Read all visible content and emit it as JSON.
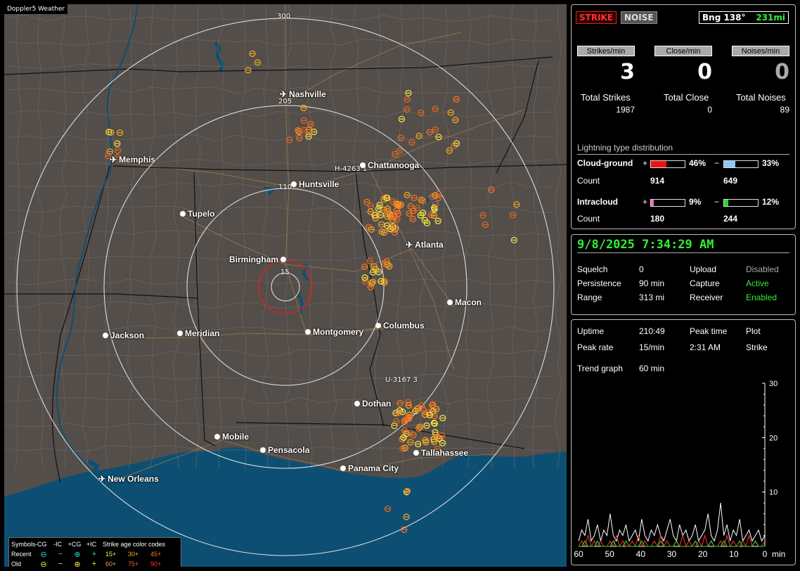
{
  "map": {
    "title": "Doppler5 Weather",
    "ring_labels": [
      "300",
      "205",
      "110",
      "15"
    ],
    "cities": [
      {
        "name": "Nashville",
        "kind": "airport"
      },
      {
        "name": "Memphis",
        "kind": "airport"
      },
      {
        "name": "Chattanooga",
        "kind": "dot"
      },
      {
        "name": "Huntsville",
        "kind": "dot"
      },
      {
        "name": "Tupelo",
        "kind": "dot"
      },
      {
        "name": "Atlanta",
        "kind": "airport"
      },
      {
        "name": "Birmingham",
        "kind": "dot"
      },
      {
        "name": "Macon",
        "kind": "dot"
      },
      {
        "name": "Jackson",
        "kind": "dot"
      },
      {
        "name": "Meridian",
        "kind": "dot"
      },
      {
        "name": "Montgomery",
        "kind": "dot"
      },
      {
        "name": "Columbus",
        "kind": "dot"
      },
      {
        "name": "Dothan",
        "kind": "dot"
      },
      {
        "name": "Mobile",
        "kind": "dot"
      },
      {
        "name": "Pensacola",
        "kind": "dot"
      },
      {
        "name": "Tallahassee",
        "kind": "dot"
      },
      {
        "name": "Panama City",
        "kind": "dot"
      },
      {
        "name": "New Orleans",
        "kind": "airport"
      }
    ],
    "highway_labels": [
      "H-4263 1",
      "U-3167 3"
    ],
    "colors": {
      "land": "#544e4a",
      "water": "#0d4f73",
      "ring": "#e8e8e8",
      "center_ring": "#e02020"
    }
  },
  "legend": {
    "header": [
      "Symbols",
      "-CG",
      "-IC",
      "+CG",
      "+IC",
      "Strike age color codes"
    ],
    "recent": {
      "label": "Recent",
      "ages": [
        "15+",
        "30+",
        "45+"
      ]
    },
    "old": {
      "label": "Old",
      "ages": [
        "60+",
        "75+",
        "90+"
      ]
    },
    "symbols": [
      "⊖",
      "−",
      "⊕",
      "+"
    ]
  },
  "status": {
    "strike_label": "STRIKE",
    "noise_label": "NOISE",
    "bearing_label": "Bng 138°",
    "distance_label": "231mi"
  },
  "rates": {
    "strikes_label": "Strikes/min",
    "strikes_value": "3",
    "close_label": "Close/min",
    "close_value": "0",
    "noises_label": "Noises/min",
    "noises_value": "0"
  },
  "totals": {
    "strikes_label": "Total Strikes",
    "strikes_value": "1987",
    "close_label": "Total Close",
    "close_value": "0",
    "noises_label": "Total Noises",
    "noises_value": "89"
  },
  "distribution": {
    "title": "Lightning type distribution",
    "cg_label": "Cloud-ground",
    "cg_plus_sign": "+",
    "cg_plus_pct": "46%",
    "cg_plus_fraction": 0.46,
    "cg_plus_color": "#ee1111",
    "cg_minus_sign": "−",
    "cg_minus_pct": "33%",
    "cg_minus_fraction": 0.33,
    "cg_minus_color": "#88c8ff",
    "cg_count_label": "Count",
    "cg_plus_count": "914",
    "cg_minus_count": "649",
    "ic_label": "Intracloud",
    "ic_plus_sign": "+",
    "ic_plus_pct": "9%",
    "ic_plus_fraction": 0.09,
    "ic_plus_color": "#ff66bb",
    "ic_minus_sign": "−",
    "ic_minus_pct": "12%",
    "ic_minus_fraction": 0.12,
    "ic_minus_color": "#22dd22",
    "ic_count_label": "Count",
    "ic_plus_count": "180",
    "ic_minus_count": "244"
  },
  "datetime": "9/8/2025 7:34:29 AM",
  "settings": {
    "squelch_label": "Squelch",
    "squelch_value": "0",
    "upload_label": "Upload",
    "upload_value": "Disabled",
    "persistence_label": "Persistence",
    "persistence_value": "90 min",
    "capture_label": "Capture",
    "capture_value": "Active",
    "range_label": "Range",
    "range_value": "313 mi",
    "receiver_label": "Receiver",
    "receiver_value": "Enabled"
  },
  "stats": {
    "uptime_label": "Uptime",
    "uptime_value": "210:49",
    "peak_time_label": "Peak time",
    "plot_label": "Plot",
    "peak_rate_label": "Peak rate",
    "peak_rate_value": "15/min",
    "peak_time_value": "2:31 AM",
    "plot_value": "Strike",
    "trend_label": "Trend graph",
    "trend_value": "60 min"
  },
  "chart_data": {
    "type": "line",
    "x_ticks": [
      "60",
      "50",
      "40",
      "30",
      "20",
      "10",
      "0"
    ],
    "x_unit": "min",
    "y_ticks": [
      "30",
      "20",
      "10"
    ],
    "ylim": [
      0,
      30
    ],
    "xlim": [
      60,
      0
    ],
    "series": [
      {
        "color": "#ffffff",
        "values": [
          1,
          3,
          2,
          5,
          1,
          2,
          4,
          1,
          3,
          2,
          6,
          2,
          1,
          3,
          2,
          4,
          1,
          2,
          3,
          1,
          5,
          2,
          1,
          3,
          2,
          4,
          2,
          1,
          3,
          5,
          2,
          1,
          4,
          2,
          3,
          1,
          2,
          4,
          1,
          2,
          3,
          6,
          2,
          1,
          3,
          8,
          2,
          4,
          1,
          3,
          2,
          5,
          1,
          2,
          3,
          1,
          2,
          3,
          1,
          2
        ]
      },
      {
        "color": "#ff3333",
        "values": [
          0,
          1,
          0,
          2,
          0,
          1,
          0,
          1,
          0,
          0,
          1,
          0,
          2,
          0,
          1,
          0,
          0,
          1,
          0,
          2,
          0,
          1,
          0,
          0,
          1,
          0,
          2,
          0,
          1,
          0,
          0,
          1,
          0,
          2,
          0,
          1,
          0,
          0,
          1,
          0,
          2,
          0,
          1,
          0,
          0,
          1,
          0,
          2,
          0,
          1,
          0,
          0,
          1,
          0,
          2,
          0,
          1,
          0,
          0,
          1
        ]
      },
      {
        "color": "#33dd33",
        "values": [
          0,
          0,
          1,
          0,
          0,
          0,
          1,
          0,
          0,
          0,
          0,
          1,
          0,
          0,
          0,
          1,
          0,
          0,
          0,
          0,
          1,
          0,
          0,
          0,
          0,
          0,
          1,
          0,
          0,
          0,
          0,
          1,
          0,
          0,
          0,
          0,
          0,
          1,
          0,
          0,
          0,
          0,
          1,
          0,
          0,
          0,
          1,
          0,
          0,
          0,
          0,
          1,
          0,
          0,
          0,
          0,
          1,
          0,
          0,
          0
        ]
      }
    ]
  }
}
